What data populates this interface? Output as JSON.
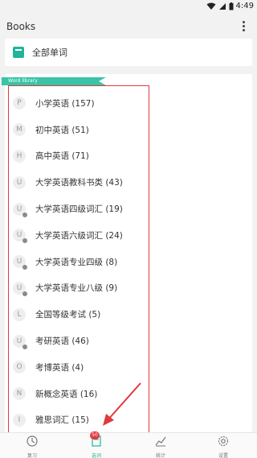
{
  "status_bar": {
    "time": "4:49"
  },
  "app_bar": {
    "title": "Books"
  },
  "all_words": {
    "label": "全部单词"
  },
  "ribbon": {
    "label": "Word library"
  },
  "word_lists": [
    {
      "letter": "P",
      "label": "小学英语 (157)",
      "has_sub": false
    },
    {
      "letter": "M",
      "label": "初中英语 (51)",
      "has_sub": false
    },
    {
      "letter": "H",
      "label": "高中英语 (71)",
      "has_sub": false
    },
    {
      "letter": "U",
      "label": "大学英语教科书类 (43)",
      "has_sub": false
    },
    {
      "letter": "U",
      "label": "大学英语四级词汇 (19)",
      "has_sub": true
    },
    {
      "letter": "U",
      "label": "大学英语六级词汇 (24)",
      "has_sub": true
    },
    {
      "letter": "U",
      "label": "大学英语专业四级 (8)",
      "has_sub": true
    },
    {
      "letter": "U",
      "label": "大学英语专业八级 (9)",
      "has_sub": true
    },
    {
      "letter": "L",
      "label": "全国等级考试 (5)",
      "has_sub": false
    },
    {
      "letter": "U",
      "label": "考研英语 (46)",
      "has_sub": true
    },
    {
      "letter": "O",
      "label": "考博英语 (4)",
      "has_sub": false
    },
    {
      "letter": "N",
      "label": "新概念英语 (16)",
      "has_sub": false
    },
    {
      "letter": "I",
      "label": "雅思词汇 (15)",
      "has_sub": false
    }
  ],
  "bottom_nav": {
    "tabs": [
      {
        "label": "复习",
        "icon": "clock-icon",
        "active": false
      },
      {
        "label": "选词",
        "icon": "book-select-icon",
        "active": true,
        "badge": "50"
      },
      {
        "label": "统计",
        "icon": "chart-icon",
        "active": false
      },
      {
        "label": "设置",
        "icon": "gear-icon",
        "active": false
      }
    ]
  },
  "colors": {
    "accent": "#1fb59a",
    "ribbon": "#38c4a7",
    "annotation": "#e03a3e"
  }
}
